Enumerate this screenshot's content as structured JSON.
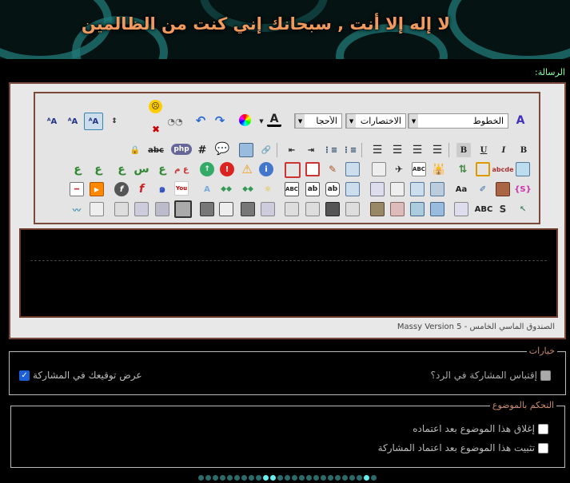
{
  "banner": {
    "title": "لا إله إلا أنت , سبحانك إني كنت من الظالمين"
  },
  "message_label": "الرسالة:",
  "toolbar": {
    "font_select": "الخطوط",
    "shortcuts_select": "الاختصارات",
    "size_select": "الأحجا",
    "abc_label": "ABC",
    "php_label": "php",
    "hash_label": "#",
    "aa_label": "Aa"
  },
  "editor_footer": "الصندوق الماسي الخامس - Massy Version 5",
  "options": {
    "legend": "خيارات",
    "quote_label": "إقتباس المشاركة في الرد؟",
    "signature_label": "عرض توقيعك في المشاركة",
    "signature_checked": true
  },
  "topic_control": {
    "legend": "التحكم بالموضوع",
    "close_label": "إغلاق هذا الموضوع بعد اعتماده",
    "pin_label": "تثبيت هذا الموضوع بعد اعتماد المشاركة"
  },
  "colors": {
    "accent_border": "#7a4a38",
    "title": "#f29a5e",
    "legend": "#c98b6a"
  }
}
